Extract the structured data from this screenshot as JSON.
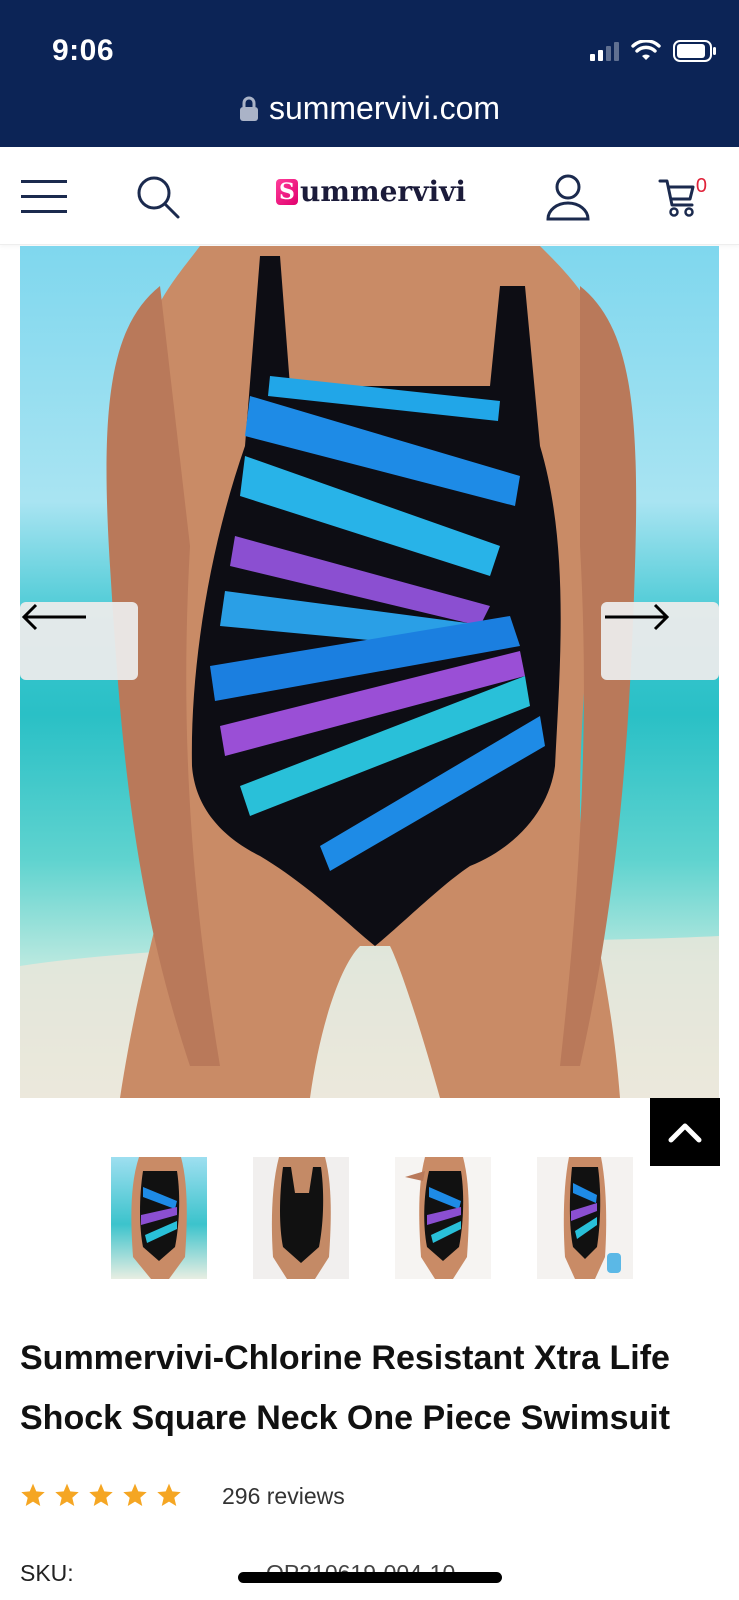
{
  "status_bar": {
    "time": "9:06"
  },
  "browser": {
    "url": "summervivi.com"
  },
  "header": {
    "logo_text": "ummervivi",
    "logo_letter": "S",
    "cart_count": "0"
  },
  "product": {
    "title": "Summervivi-Chlorine Resistant Xtra Life Shock Square Neck One Piece Swimsuit",
    "rating_stars": 5,
    "reviews": "296 reviews",
    "sku_label": "SKU:",
    "sku_value": "OP210619-004-10"
  },
  "colors": {
    "browser_bar": "#0c2456",
    "star": "#f5a623",
    "cart_badge": "#e0233a"
  },
  "icons": [
    "menu-icon",
    "search-icon",
    "user-icon",
    "cart-icon",
    "arrow-left-icon",
    "arrow-right-icon",
    "chevron-up-icon",
    "lock-icon",
    "star-icon"
  ],
  "thumbnails": [
    "front-view",
    "back-view",
    "side-view",
    "full-view"
  ]
}
